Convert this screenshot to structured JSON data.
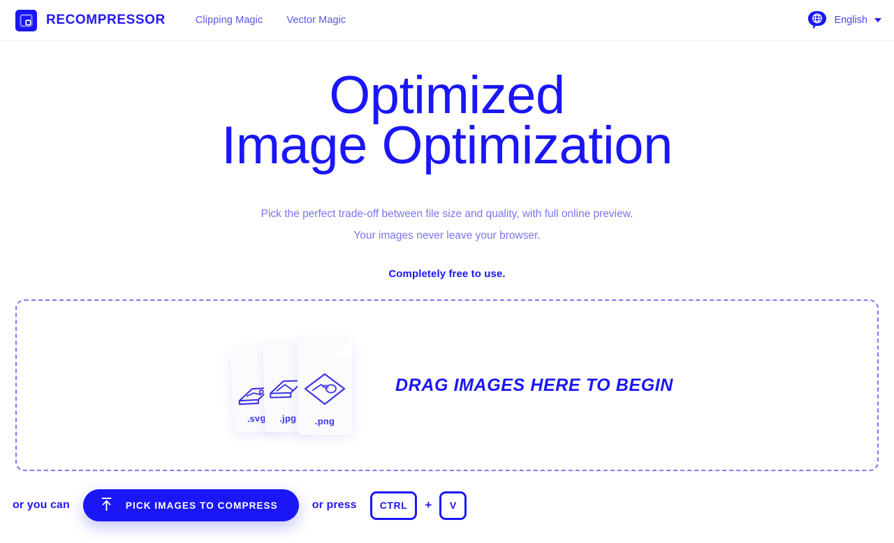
{
  "header": {
    "brand_name": "RECOMPRESSOR",
    "logo_icon": "recompressor-square-logo-icon",
    "nav": [
      {
        "label": "Clipping Magic"
      },
      {
        "label": "Vector Magic"
      }
    ],
    "language": {
      "label": "English",
      "globe_icon": "globe-icon",
      "caret_icon": "chevron-down-icon"
    }
  },
  "hero": {
    "headline_line1": "Optimized",
    "headline_line2": "Image Optimization",
    "sub_line1": "Pick the perfect trade-off between file size and quality, with full online preview.",
    "sub_line2": "Your images never leave your browser.",
    "free_note": "Completely free to use."
  },
  "dropzone": {
    "drag_text": "DRAG IMAGES HERE TO BEGIN",
    "cards": [
      {
        "ext": ".svg"
      },
      {
        "ext": ".jpg"
      },
      {
        "ext": ".png"
      }
    ]
  },
  "actions": {
    "hint_before": "or you can",
    "pick_button_label": "PICK IMAGES TO COMPRESS",
    "pick_button_icon": "upload-arrow-icon",
    "hint_after": "or press",
    "key_modifier": "CTRL",
    "key_plus": "+",
    "key_letter": "V"
  },
  "colors": {
    "brand_blue": "#1a16f5",
    "link_blue": "#5b55e8",
    "muted_blue": "#7b74ee",
    "dashed_border": "#7c79f0",
    "header_border": "#edecfb"
  }
}
